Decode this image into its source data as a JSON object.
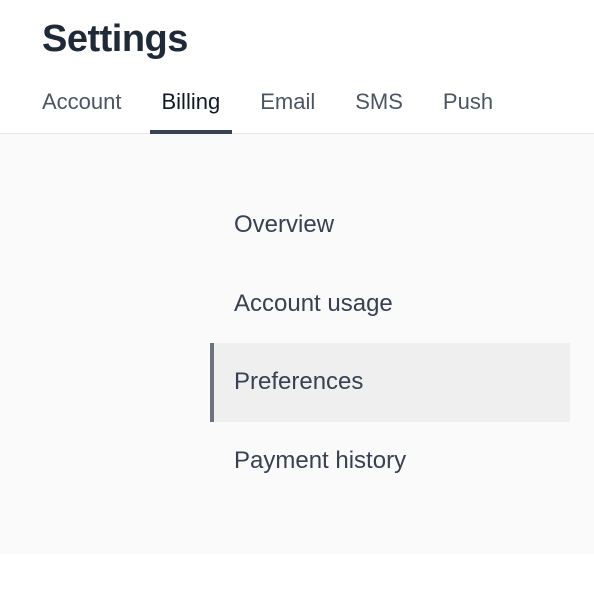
{
  "header": {
    "title": "Settings"
  },
  "tabs": {
    "items": [
      {
        "label": "Account",
        "active": false
      },
      {
        "label": "Billing",
        "active": true
      },
      {
        "label": "Email",
        "active": false
      },
      {
        "label": "SMS",
        "active": false
      },
      {
        "label": "Push",
        "active": false
      }
    ]
  },
  "subnav": {
    "items": [
      {
        "label": "Overview",
        "active": false
      },
      {
        "label": "Account usage",
        "active": false
      },
      {
        "label": "Preferences",
        "active": true
      },
      {
        "label": "Payment history",
        "active": false
      }
    ]
  }
}
